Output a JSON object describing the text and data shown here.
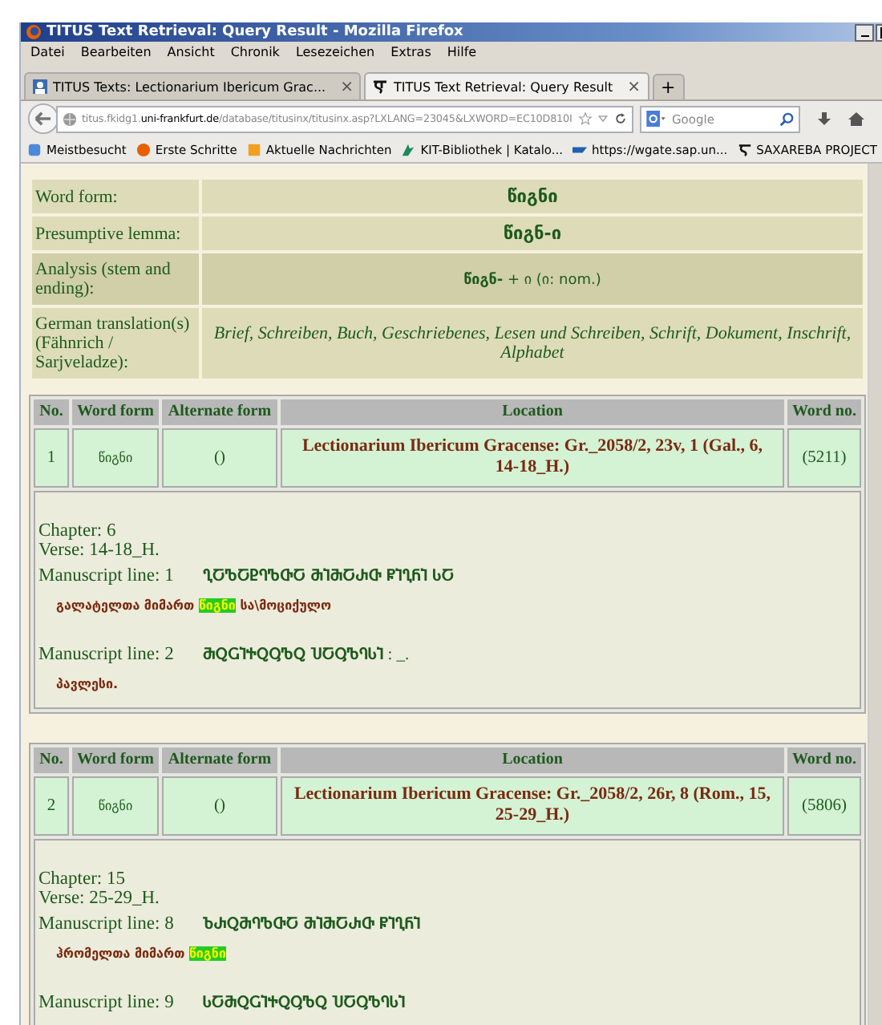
{
  "window": {
    "title": "TITUS Text Retrieval: Query Result - Mozilla Firefox"
  },
  "menu": [
    "Datei",
    "Bearbeiten",
    "Ansicht",
    "Chronik",
    "Lesezeichen",
    "Extras",
    "Hilfe"
  ],
  "tabs": [
    {
      "label": "TITUS Texts: Lectionarium Ibericum Grac...",
      "close": "×",
      "selected": false
    },
    {
      "label": "TITUS Text Retrieval: Query Result",
      "close": "×",
      "selected": true
    }
  ],
  "new_tab": "+",
  "address": {
    "host_pre": "titus.fkidg1.",
    "host": "uni-frankfurt.de",
    "path": "/database/titusinx/titusinx.asp?LXLANG=23045&LXWORD=EC10D810I"
  },
  "search": {
    "placeholder": "Google"
  },
  "bookmarks": [
    "Meistbesucht",
    "Erste Schritte",
    "Aktuelle Nachrichten",
    "KIT-Bibliothek | Katalo...",
    "https://wgate.sap.un...",
    "SAXAREBA PROJECT"
  ],
  "info": [
    {
      "label": "Word form:",
      "value": "წიგნი",
      "kind": "form"
    },
    {
      "label": "Presumptive lemma:",
      "value": "წიგნ-ი",
      "kind": "lemma"
    },
    {
      "label": "Analysis (stem and ending):",
      "value": "წიგნ-",
      "rest": " + ი (ი: nom.)",
      "kind": "analysis"
    },
    {
      "label": "German translation(s) (Fähnrich / Sarjveladze):",
      "value": "Brief, Schreiben, Buch, Geschriebenes, Lesen und Schreiben, Schrift, Dokument, Inschrift, Alphabet",
      "kind": "translation"
    }
  ],
  "results": [
    {
      "columns": [
        "No.",
        "Word form",
        "Alternate form",
        "Location",
        "Word no."
      ],
      "no": "1",
      "form": "წიგნი",
      "alternate": "()",
      "location": "Lectionarium Ibericum Gracense: Gr._2058/2, 23v, 1 (Gal., 6, 14-18_H.)",
      "word_no": "(5211)",
      "chapter": "Chapter: 6",
      "verse": "Verse: 14-18_H.",
      "lines": [
        {
          "label": "Manuscript line: 1",
          "asomtavruli": "ႢႠႪႠႲႤႪႧႠ ႫႨႫႠႰႧ ႼႨႢႬႨ ႱႠ",
          "before": "გალატელთა მიმართ ",
          "highlight": "წიგნი",
          "after": " სა\\მოციქულო"
        },
        {
          "label": "Manuscript line: 2",
          "asomtavruli": "ႫႭႺႨႵႭႳႪႭ ႮႠႳႪႤႱႨ",
          "tail": " : _.",
          "before": "პავლესი."
        }
      ]
    },
    {
      "columns": [
        "No.",
        "Word form",
        "Alternate form",
        "Location",
        "Word no."
      ],
      "no": "2",
      "form": "წიგნი",
      "alternate": "()",
      "location": "Lectionarium Ibericum Gracense: Gr._2058/2, 26r, 8 (Rom., 15, 25-29_H.)",
      "word_no": "(5806)",
      "chapter": "Chapter: 15",
      "verse": "Verse: 25-29_H.",
      "lines": [
        {
          "label": "Manuscript line: 8",
          "asomtavruli": "ႦႰႭႫႤႪႧႠ ႫႨႫႠႰႧ ႼႨႢႬႨ",
          "before": "ჰრომელთა მიმართ ",
          "highlight": "წიგნი"
        },
        {
          "label": "Manuscript line: 9",
          "asomtavruli": "ႱႠႫႭႺႨႵႭႳႪႭ ႮႠႳႪႤႱႨ"
        }
      ]
    }
  ]
}
